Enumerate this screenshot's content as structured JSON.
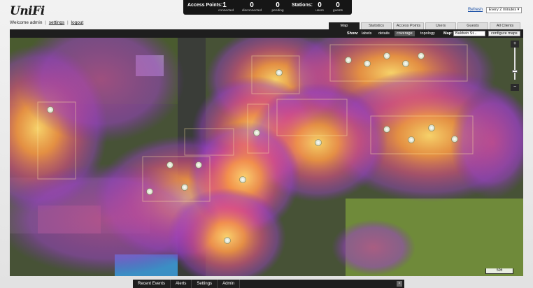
{
  "header": {
    "logo": "UniFi",
    "welcome": "Welcome admin",
    "settings_link": "settings",
    "logout_link": "logout",
    "separator": "|"
  },
  "stats": {
    "access_points_label": "Access Points:",
    "connected_value": "1",
    "connected_label": "connected",
    "disconnected_value": "0",
    "disconnected_label": "disconnected",
    "pending_value": "0",
    "pending_label": "pending",
    "stations_label": "Stations:",
    "users_value": "0",
    "users_label": "users",
    "guests_value": "0",
    "guests_label": "guests"
  },
  "refresh": {
    "link": "Refresh",
    "interval": "Every 2 minutes"
  },
  "tabs": [
    "Map",
    "Statistics",
    "Access Points",
    "Users",
    "Guests",
    "All Clients"
  ],
  "toolbar": {
    "show_label": "Show:",
    "labels": "labels",
    "details": "details",
    "coverage": "coverage",
    "topology": "topology",
    "map_label": "Map:",
    "map_value": "Baldwin St...",
    "configure": "configure maps"
  },
  "map": {
    "scale_label": "50ft",
    "zoom_in": "+",
    "zoom_out": "−",
    "colors": {
      "heat_core": "#ffd56a",
      "heat_mid": "#ff7a3a",
      "heat_edge": "#9b3fc7",
      "ap_dot": "#e9ecd8"
    }
  },
  "bottom_bar": {
    "recent_events": "Recent Events",
    "alerts": "Alerts",
    "settings": "Settings",
    "admin": "Admin",
    "close": "×"
  }
}
